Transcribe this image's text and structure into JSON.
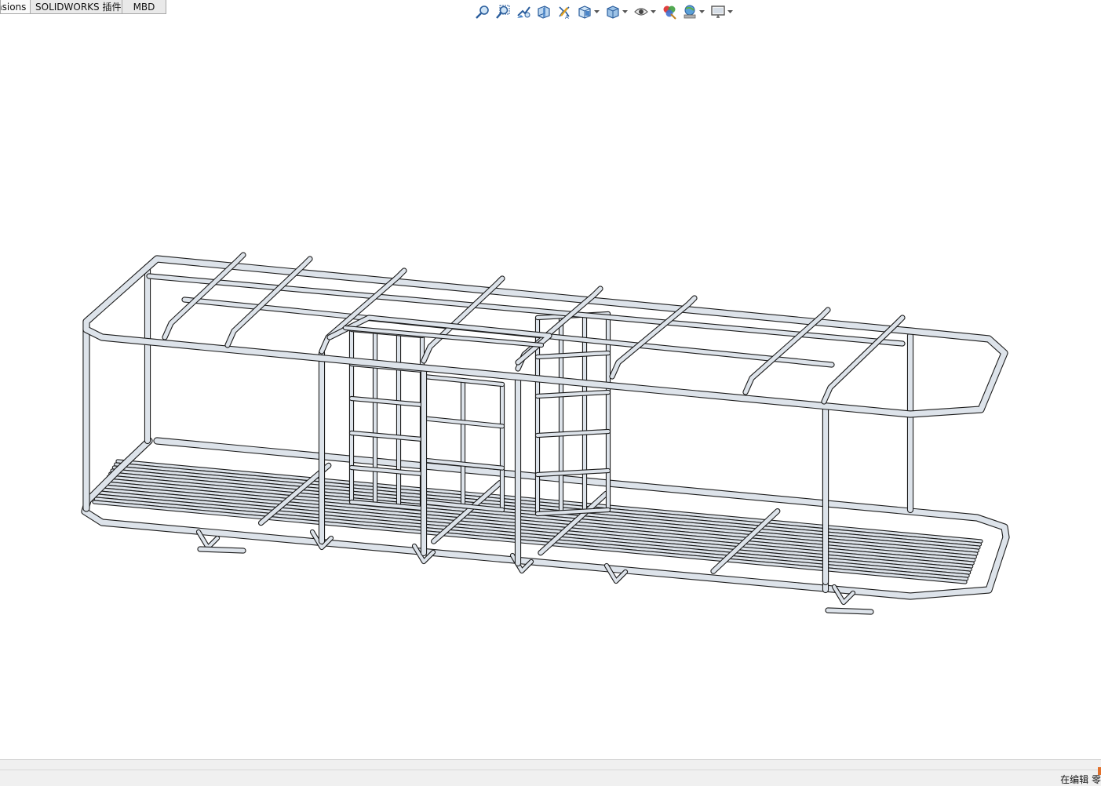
{
  "tabs": [
    "nsions",
    "SOLIDWORKS 插件",
    "MBD"
  ],
  "toolbar": {
    "icons": [
      {
        "name": "zoom-to-fit-icon",
        "dropdown": false
      },
      {
        "name": "zoom-to-area-icon",
        "dropdown": false
      },
      {
        "name": "previous-view-icon",
        "dropdown": false
      },
      {
        "name": "section-view-icon",
        "dropdown": false
      },
      {
        "name": "dynamic-annotation-views-icon",
        "dropdown": false
      },
      {
        "name": "view-orientation-icon",
        "dropdown": true
      },
      {
        "name": "display-style-icon",
        "dropdown": true
      },
      {
        "name": "hide-show-items-icon",
        "dropdown": true
      },
      {
        "name": "edit-appearance-icon",
        "dropdown": false
      },
      {
        "name": "apply-scene-icon",
        "dropdown": true
      },
      {
        "name": "view-settings-icon",
        "dropdown": true
      }
    ]
  },
  "status": {
    "text": "在编辑 零件"
  },
  "colors": {
    "tube_fill": "#dde3ea",
    "tube_edge": "#1c1c1c",
    "background": "#ffffff"
  }
}
